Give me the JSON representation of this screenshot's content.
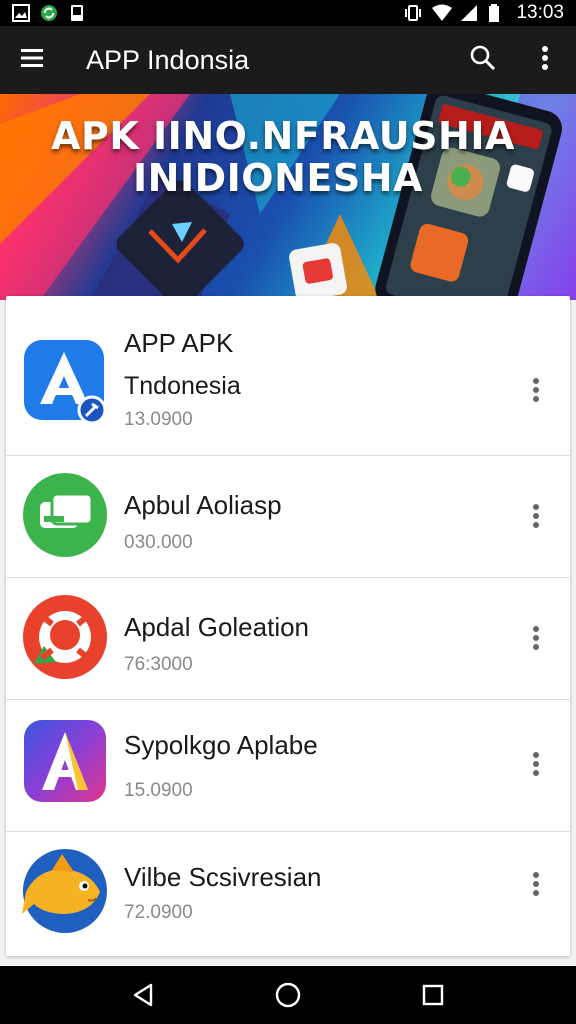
{
  "status_bar": {
    "time": "13:03",
    "icons": [
      "gallery-icon",
      "sync-icon",
      "notification-icon",
      "vibrate-icon",
      "wifi-icon",
      "signal-icon",
      "battery-icon"
    ]
  },
  "app_bar": {
    "title": "APP Indonsia",
    "icons": [
      "menu-icon",
      "search-icon",
      "more-vert-icon"
    ]
  },
  "banner": {
    "line1": "APK IINO.NFRAUSHIA",
    "line2": "INIDIONESHA"
  },
  "apps": [
    {
      "name": "APP APK",
      "subtitle": "Tndonesia",
      "meta": "13.0900",
      "icon": "app-apk-icon",
      "color": "#1e7be8"
    },
    {
      "name": "Apbul Aoliasp",
      "subtitle": "",
      "meta": "030.000",
      "icon": "chat-app-icon",
      "color": "#3cb44b"
    },
    {
      "name": "Apdal Goleation",
      "subtitle": "",
      "meta": "76:3000",
      "icon": "location-app-icon",
      "color": "#e8412c"
    },
    {
      "name": "Sypolkgo Aplabe",
      "subtitle": "",
      "meta": "15.0900",
      "icon": "a-letter-app-icon",
      "color": "#7b3fd6"
    },
    {
      "name": "Vilbe Scsivresian",
      "subtitle": "",
      "meta": "72.0900",
      "icon": "fish-app-icon",
      "color": "#f5b324"
    }
  ],
  "nav_bar": {
    "icons": [
      "back-icon",
      "home-icon",
      "recents-icon"
    ]
  }
}
